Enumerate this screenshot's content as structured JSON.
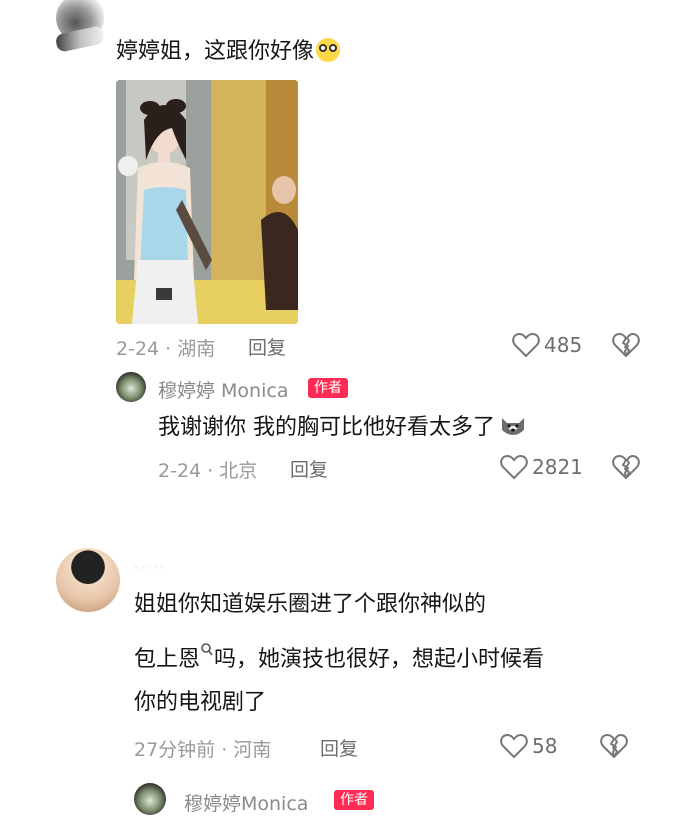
{
  "comments": [
    {
      "text": "婷婷姐，这跟你好像",
      "emoji": "eyes-emoji",
      "meta": "2-24 · 湖南",
      "reply_label": "回复",
      "likes": "485",
      "reply": {
        "author": "穆婷婷 Monica",
        "badge": "作者",
        "text": "我谢谢你 我的胸可比他好看太多了",
        "emoji": "dog-emoji",
        "meta": "2-24 · 北京",
        "reply_label": "回复",
        "likes": "2821"
      }
    },
    {
      "text_line1": "姐姐你知道娱乐圈进了个跟你神似的",
      "text_line2": "包上恩",
      "text_line2_rest": "吗，她演技也很好，想起小时候看",
      "text_line3": "你的电视剧了",
      "meta": "27分钟前 · 河南",
      "reply_label": "回复",
      "likes": "58",
      "reply": {
        "author": "穆婷婷Monica",
        "badge": "作者"
      }
    }
  ]
}
